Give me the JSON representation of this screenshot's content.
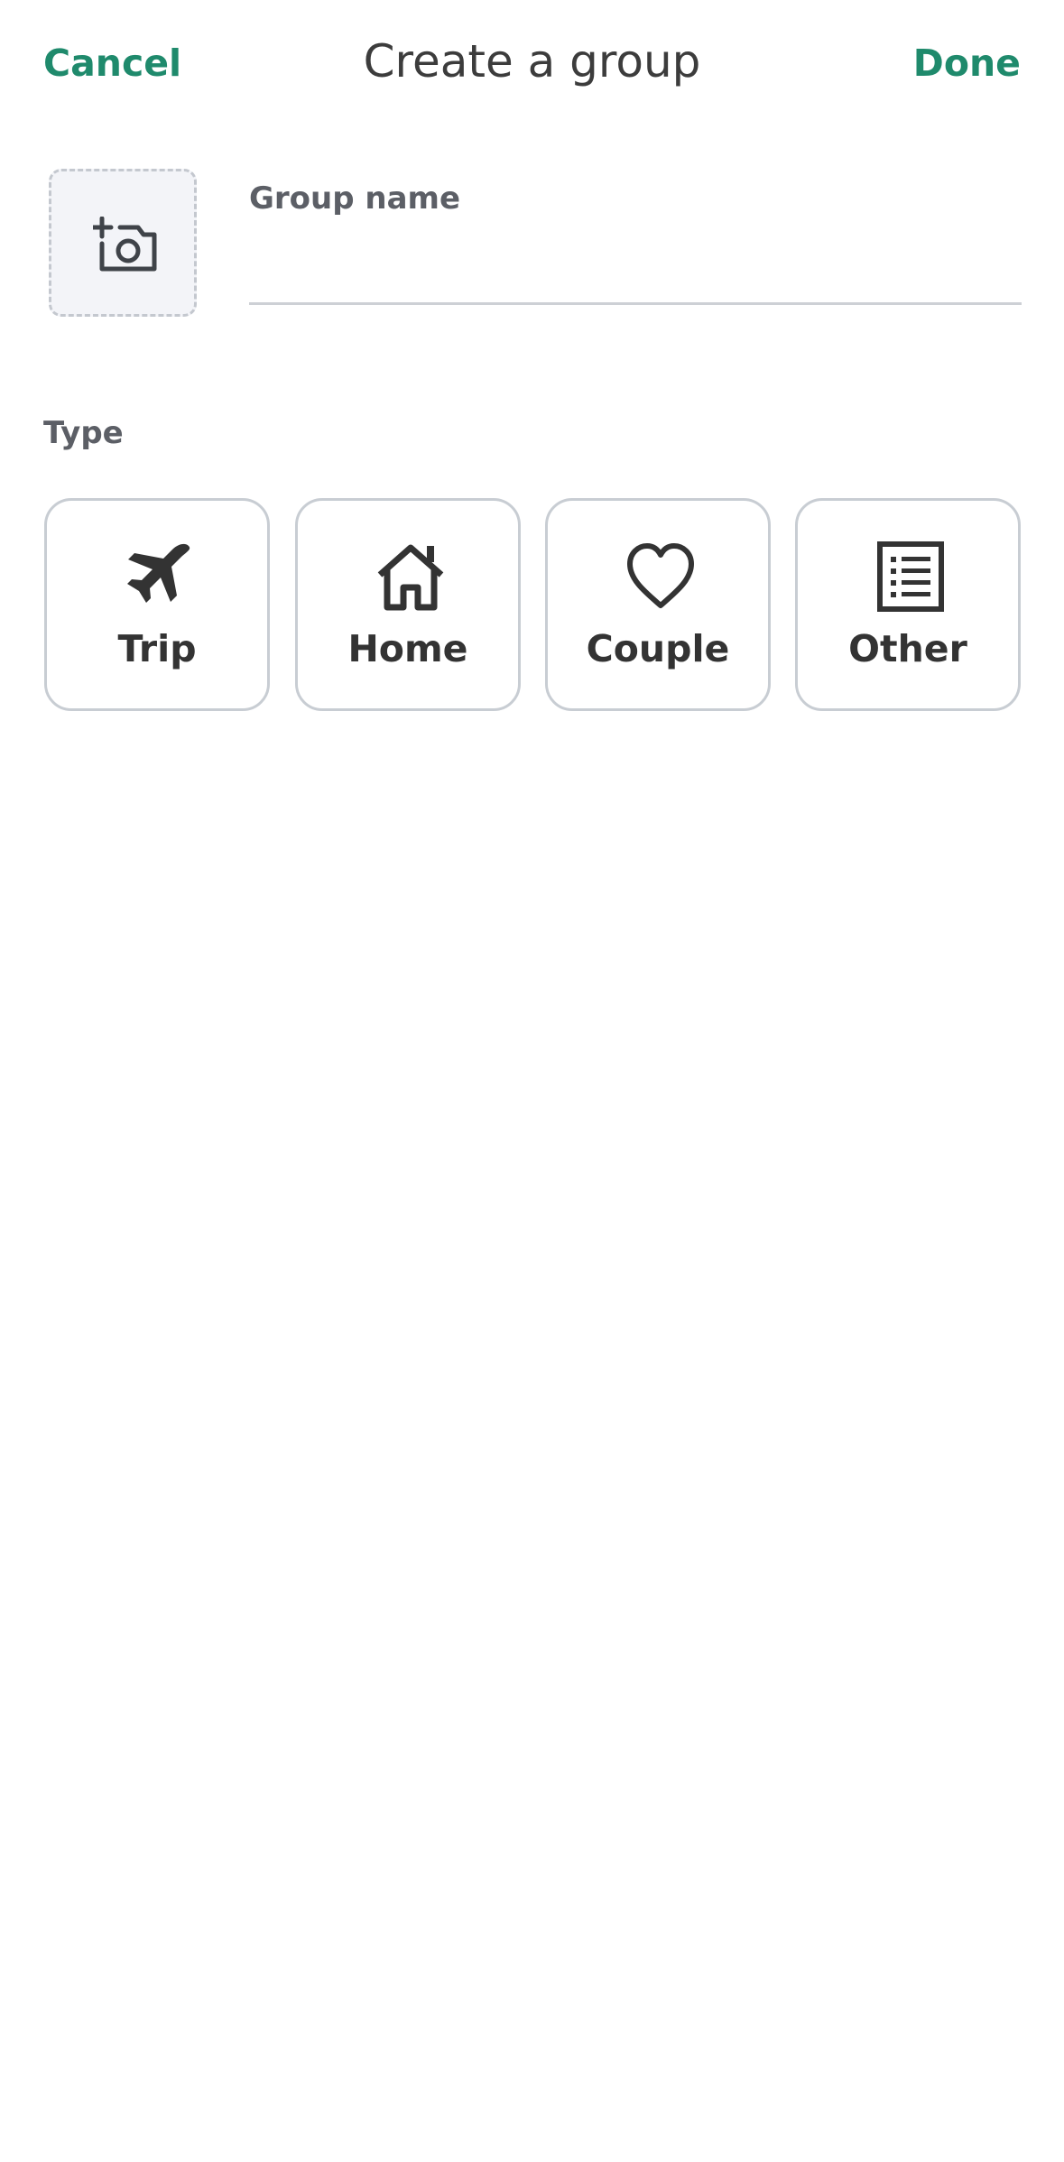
{
  "header": {
    "cancel_label": "Cancel",
    "title": "Create a group",
    "done_label": "Done"
  },
  "avatar": {
    "icon": "add-photo-icon"
  },
  "group_name": {
    "label": "Group name",
    "value": "",
    "placeholder": ""
  },
  "type_section": {
    "label": "Type",
    "options": [
      {
        "label": "Trip",
        "icon": "airplane-icon"
      },
      {
        "label": "Home",
        "icon": "house-icon"
      },
      {
        "label": "Couple",
        "icon": "heart-icon"
      },
      {
        "label": "Other",
        "icon": "list-icon"
      }
    ]
  },
  "colors": {
    "accent": "#1f8a6c",
    "text": "#333333",
    "muted_label": "#5c5f66",
    "border": "#c8cdd3",
    "avatar_bg": "#f3f4f8"
  }
}
